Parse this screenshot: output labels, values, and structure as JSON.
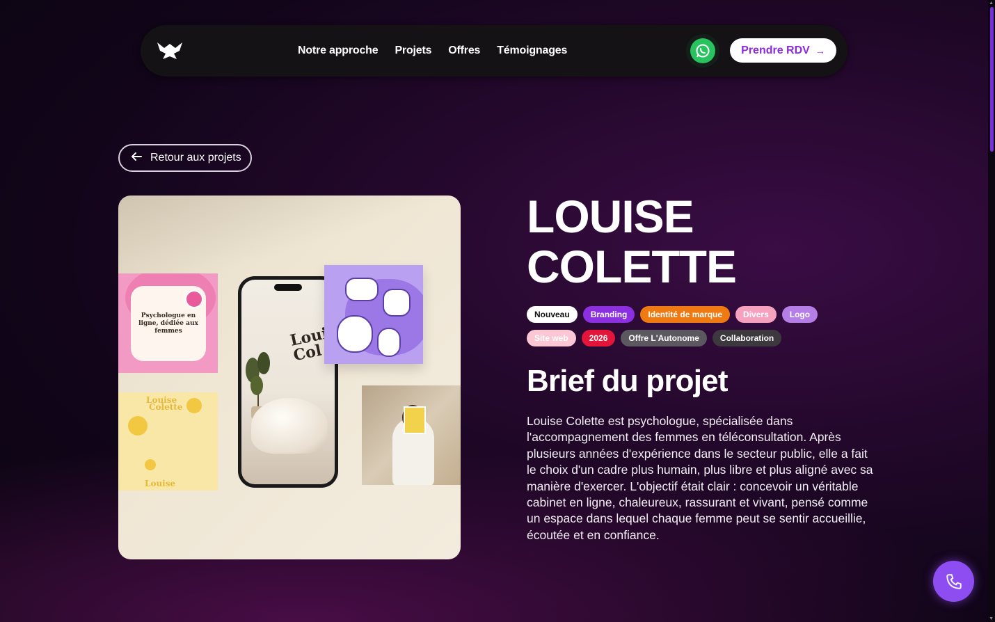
{
  "nav": {
    "links": [
      "Notre approche",
      "Projets",
      "Offres",
      "Témoignages"
    ],
    "cta_label": "Prendre RDV",
    "cta_arrow": "→"
  },
  "back_button": {
    "label": "Retour aux projets"
  },
  "project": {
    "title_line1": "LOUISE",
    "title_line2": "COLETTE",
    "tags_row1": [
      {
        "label": "Nouveau",
        "bg": "#ffffff",
        "fg": "#111111"
      },
      {
        "label": "Branding",
        "bg": "#8b2fe0",
        "fg": "#ffffff"
      },
      {
        "label": "Identité de marque",
        "bg": "#f07a12",
        "fg": "#ffffff"
      },
      {
        "label": "Divers",
        "bg": "#f6a2bf",
        "fg": "#ffffff"
      },
      {
        "label": "Logo",
        "bg": "#b57de6",
        "fg": "#ffffff"
      }
    ],
    "tags_row2": [
      {
        "label": "Site web",
        "bg": "#fbc7d4",
        "fg": "#ffffff"
      },
      {
        "label": "2026",
        "bg": "#e3153a",
        "fg": "#ffffff"
      },
      {
        "label": "Offre L'Autonome",
        "bg": "#5c5860",
        "fg": "#ffffff"
      },
      {
        "label": "Collaboration",
        "bg": "#3c383e",
        "fg": "#ffffff"
      }
    ],
    "brief_heading": "Brief du projet",
    "brief_text": "Louise Colette est psychologue, spécialisée dans l'accompagnement des femmes en téléconsultation. Après plusieurs années d'expérience dans le secteur public, elle a fait le choix d'un cadre plus humain, plus libre et plus aligné avec sa manière d'exercer. L'objectif était clair : concevoir un véritable cabinet en ligne, chaleureux, rassurant et vivant, pensé comme un espace dans lequel chaque femme peut se sentir accueillie, écoutée et en confiance."
  },
  "mockup": {
    "pink_card_text": "Psychologue en ligne, dédiée aux femmes",
    "phone_text_1": "Louis",
    "phone_text_2": "Col",
    "yellow_text_1": "Louise",
    "yellow_text_2": "Colette",
    "yellow_text_3": "Louise"
  },
  "icons": {
    "logo": "brand-logo-icon",
    "whatsapp": "whatsapp-icon",
    "back": "arrow-left-icon",
    "call": "phone-icon"
  },
  "colors": {
    "accent": "#8a2be2",
    "whatsapp": "#28c35e",
    "fab": "#8d4df0"
  }
}
